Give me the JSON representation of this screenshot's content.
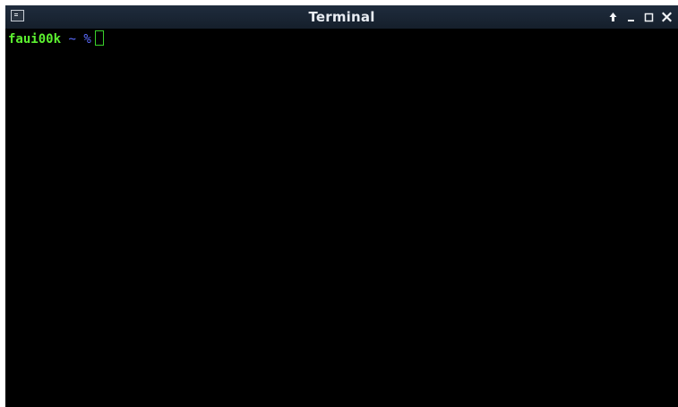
{
  "window": {
    "title": "Terminal",
    "icons": {
      "app": "terminal-app-icon",
      "raise": "arrow-up-icon",
      "minimize": "minimize-icon",
      "maximize": "maximize-icon",
      "close": "close-icon"
    }
  },
  "terminal": {
    "prompt_host": "faui00k",
    "prompt_path": "~",
    "prompt_symbol": "%"
  },
  "colors": {
    "titlebar": "#1a2634",
    "terminal_background": "#000000",
    "prompt_host": "#5cf030",
    "prompt_symbols": "#5b6bff",
    "cursor": "#39d02a"
  }
}
